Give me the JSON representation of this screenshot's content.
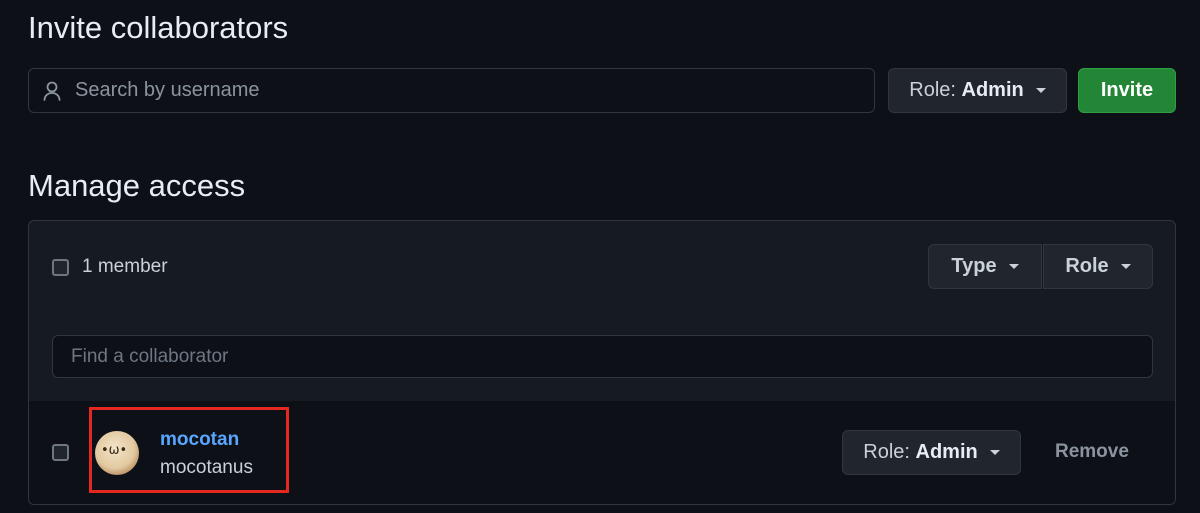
{
  "invite": {
    "title": "Invite collaborators",
    "search_placeholder": "Search by username",
    "role_label": "Role:",
    "role_value": "Admin",
    "invite_button": "Invite"
  },
  "manage": {
    "title": "Manage access",
    "member_count": "1 member",
    "type_filter": "Type",
    "role_filter": "Role",
    "find_placeholder": "Find a collaborator",
    "members": [
      {
        "name": "mocotan",
        "login": "mocotanus",
        "role_label": "Role:",
        "role_value": "Admin",
        "remove_label": "Remove"
      }
    ]
  },
  "icons": {
    "search": "person-icon",
    "dropdown": "caret-down-icon"
  },
  "colors": {
    "accent": "#58a6ff",
    "invite_green": "#238636",
    "highlight": "#e5281f"
  }
}
